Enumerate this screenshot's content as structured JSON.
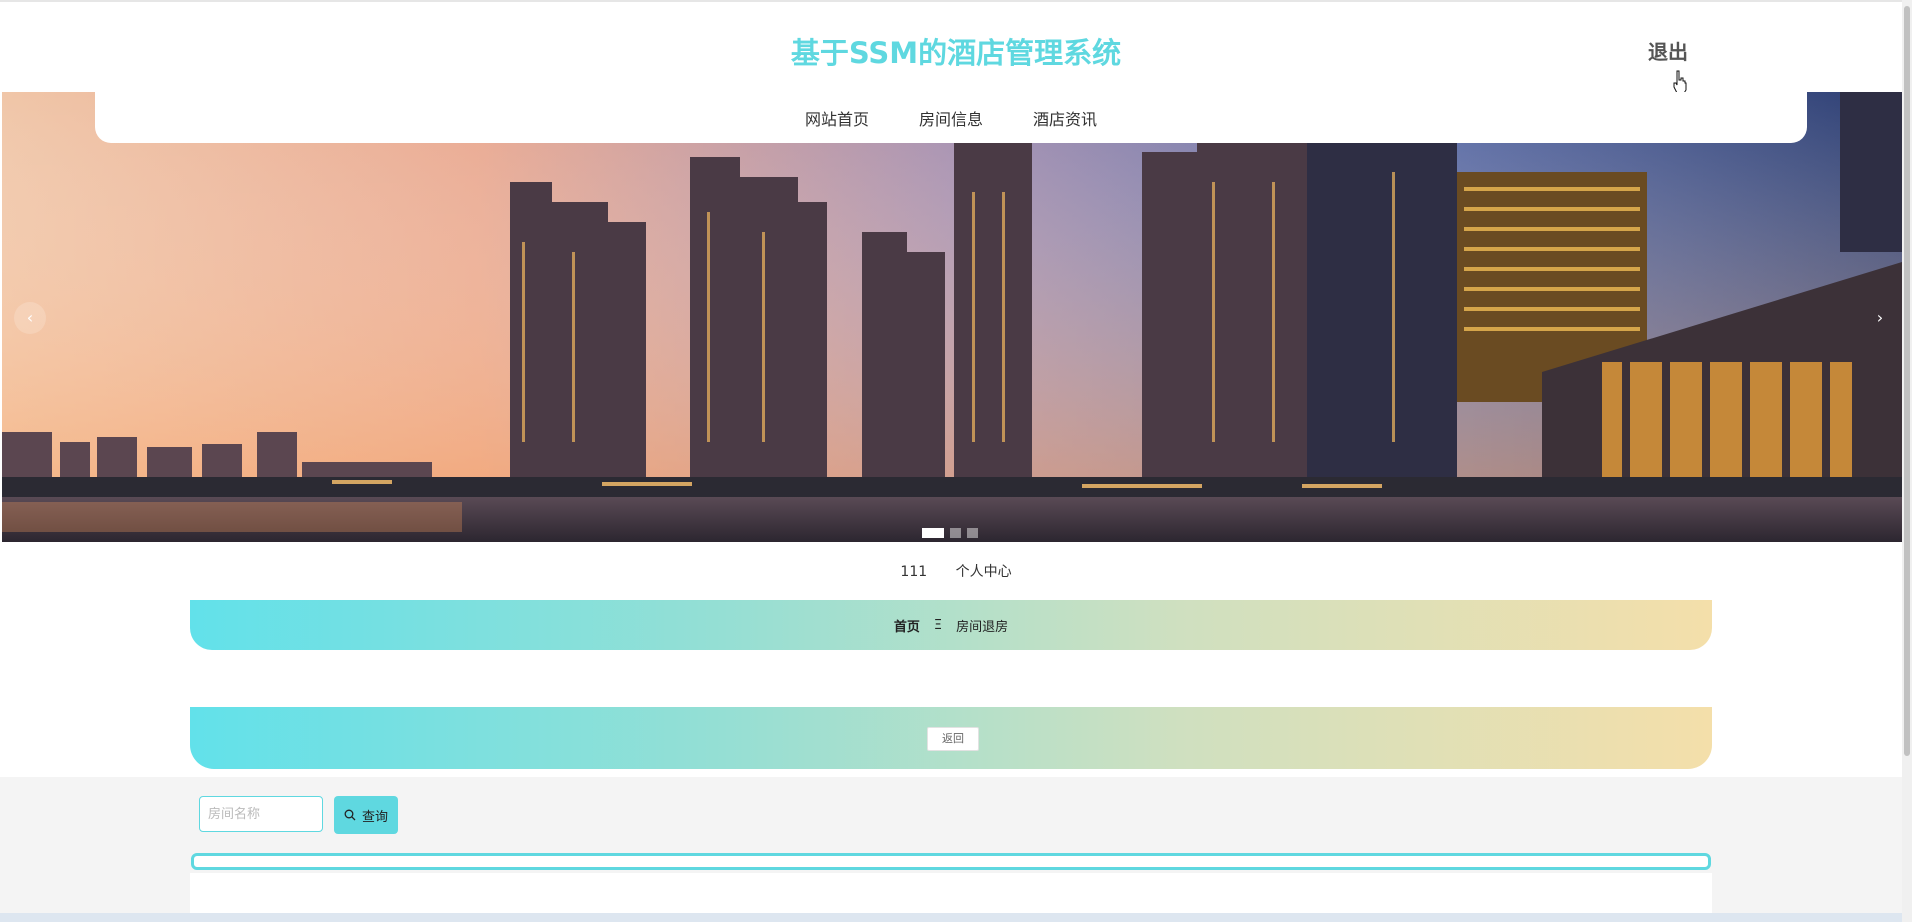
{
  "header": {
    "title": "基于SSM的酒店管理系统",
    "logout_label": "退出"
  },
  "nav": {
    "items": [
      {
        "label": "网站首页"
      },
      {
        "label": "房间信息"
      },
      {
        "label": "酒店资讯"
      }
    ]
  },
  "carousel": {
    "prev_glyph": "‹",
    "next_glyph": "›",
    "slide_count": 3,
    "active_index": 0
  },
  "userbar": {
    "username": "111",
    "center_label": "个人中心"
  },
  "breadcrumb": {
    "home": "首页",
    "separator": "Ξ",
    "current": "房间退房"
  },
  "actions": {
    "back_label": "返回"
  },
  "search": {
    "placeholder": "房间名称",
    "button_label": "查询",
    "button_icon": "search-icon"
  },
  "colors": {
    "accent": "#5fd8e0",
    "gradient_start": "#62e1ea",
    "gradient_end": "#f4dfaa"
  }
}
